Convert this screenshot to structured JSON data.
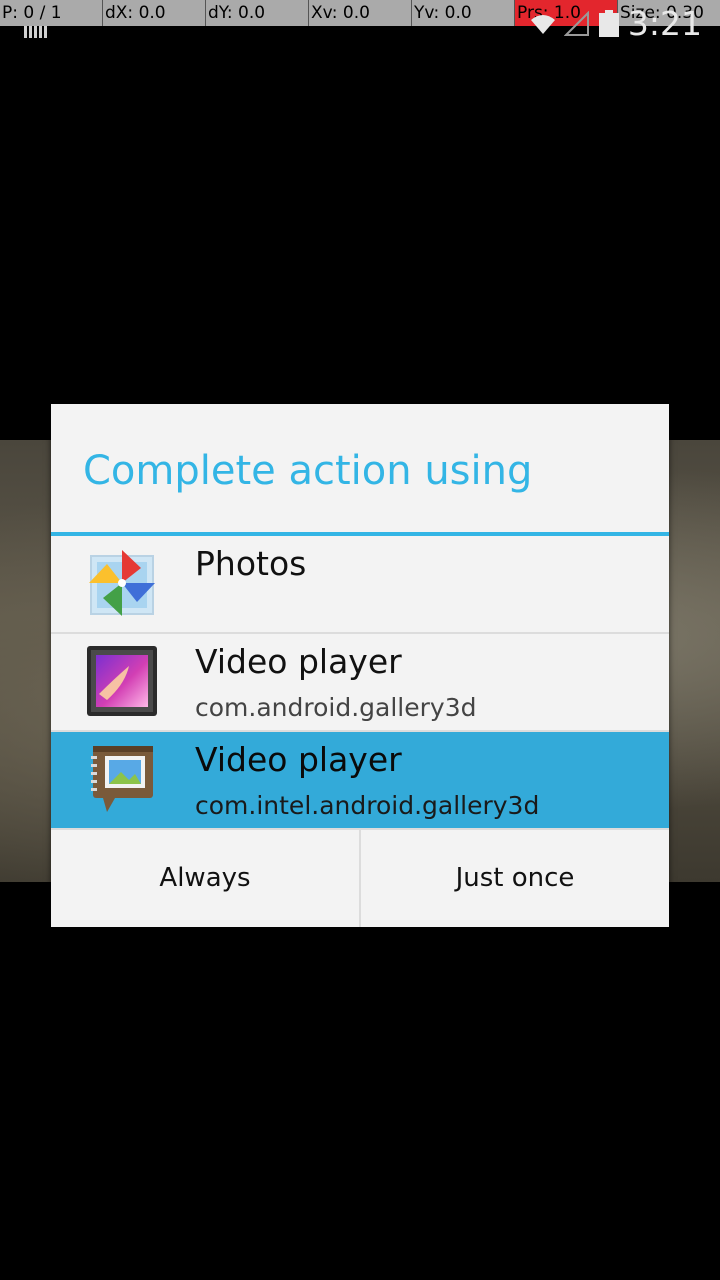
{
  "debug_bar": {
    "pointer": "P: 0 / 1",
    "dx": "dX: 0.0",
    "dy": "dY: 0.0",
    "xv": "Xv: 0.0",
    "yv": "Yv: 0.0",
    "prs": "Prs: 1.0",
    "size": "Size: 0.30"
  },
  "status_bar": {
    "time": "3:21",
    "icons": [
      "notification-icon",
      "wifi-icon",
      "signal-icon",
      "battery-icon"
    ]
  },
  "dialog": {
    "title": "Complete action using",
    "accent_color": "#33b5e5",
    "apps": [
      {
        "name": "Photos",
        "package": "",
        "icon": "photos-pinwheel-icon",
        "selected": false
      },
      {
        "name": "Video player",
        "package": "com.android.gallery3d",
        "icon": "gallery-icon",
        "selected": false
      },
      {
        "name": "Video player",
        "package": "com.intel.android.gallery3d",
        "icon": "intel-gallery-icon",
        "selected": true
      }
    ],
    "selected_color": "#33aad9",
    "buttons": {
      "always": "Always",
      "just_once": "Just once"
    }
  }
}
